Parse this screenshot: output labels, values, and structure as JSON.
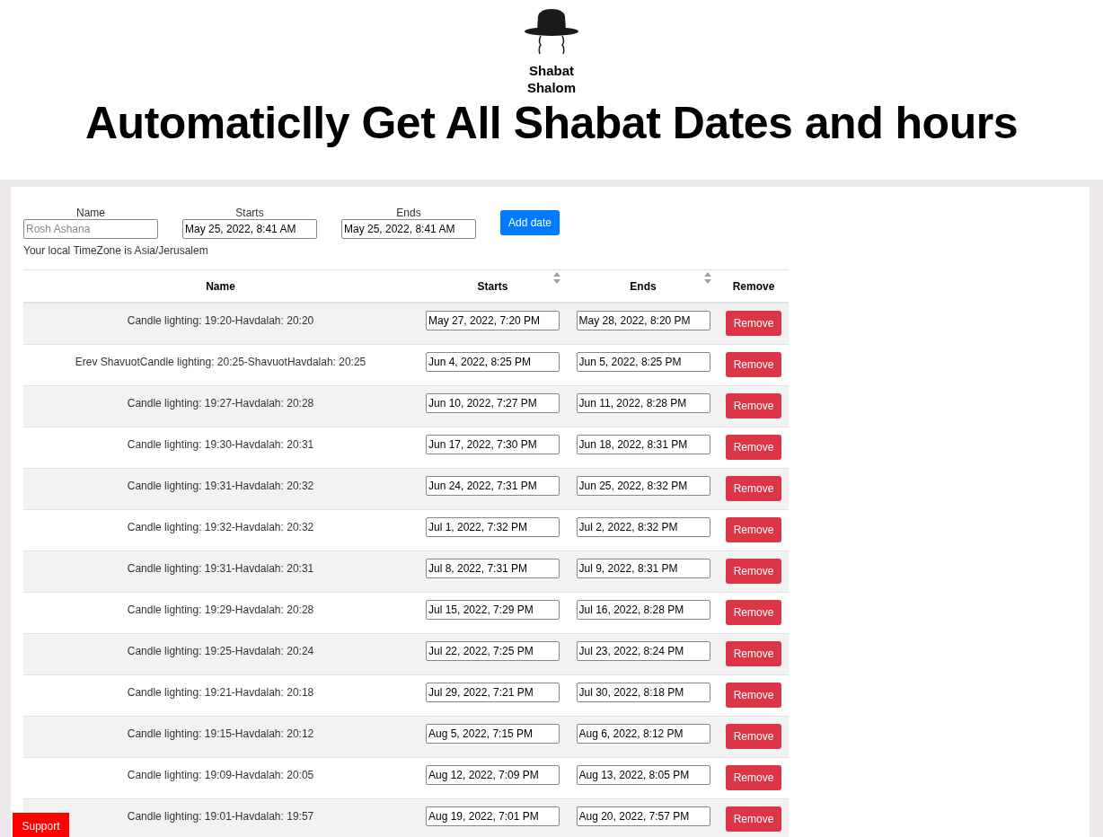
{
  "logo": {
    "text": [
      "Shabat",
      "Shalom"
    ]
  },
  "title": "Automaticlly Get All Shabat Dates and hours",
  "form": {
    "fields": [
      {
        "label": "Name",
        "placeholder": "Rosh Ashana"
      },
      {
        "label": "Starts",
        "value": "May 25, 2022, 8:41 AM"
      },
      {
        "label": "Ends",
        "value": "May 25, 2022, 8:41 AM"
      }
    ],
    "add_button": "Add date",
    "timezone_note": "Your local TimeZone is Asia/Jerusalem"
  },
  "table": {
    "columns": [
      {
        "label": "Name",
        "sortable": false
      },
      {
        "label": "Starts",
        "sortable": true
      },
      {
        "label": "Ends",
        "sortable": true
      },
      {
        "label": "Remove",
        "sortable": false
      }
    ],
    "rows": [
      {
        "name": "Candle lighting: 19:20-Havdalah: 20:20",
        "starts": "May 27, 2022, 7:20 PM",
        "ends": "May 28, 2022, 8:20 PM",
        "button": "Remove"
      },
      {
        "name": "Erev ShavuotCandle lighting: 20:25-ShavuotHavdalah: 20:25",
        "starts": "Jun 4, 2022, 8:25 PM",
        "ends": "Jun 5, 2022, 8:25 PM",
        "button": "Remove"
      },
      {
        "name": "Candle lighting: 19:27-Havdalah: 20:28",
        "starts": "Jun 10, 2022, 7:27 PM",
        "ends": "Jun 11, 2022, 8:28 PM",
        "button": "Remove"
      },
      {
        "name": "Candle lighting: 19:30-Havdalah: 20:31",
        "starts": "Jun 17, 2022, 7:30 PM",
        "ends": "Jun 18, 2022, 8:31 PM",
        "button": "Remove"
      },
      {
        "name": "Candle lighting: 19:31-Havdalah: 20:32",
        "starts": "Jun 24, 2022, 7:31 PM",
        "ends": "Jun 25, 2022, 8:32 PM",
        "button": "Remove"
      },
      {
        "name": "Candle lighting: 19:32-Havdalah: 20:32",
        "starts": "Jul 1, 2022, 7:32 PM",
        "ends": "Jul 2, 2022, 8:32 PM",
        "button": "Remove"
      },
      {
        "name": "Candle lighting: 19:31-Havdalah: 20:31",
        "starts": "Jul 8, 2022, 7:31 PM",
        "ends": "Jul 9, 2022, 8:31 PM",
        "button": "Remove"
      },
      {
        "name": "Candle lighting: 19:29-Havdalah: 20:28",
        "starts": "Jul 15, 2022, 7:29 PM",
        "ends": "Jul 16, 2022, 8:28 PM",
        "button": "Remove"
      },
      {
        "name": "Candle lighting: 19:25-Havdalah: 20:24",
        "starts": "Jul 22, 2022, 7:25 PM",
        "ends": "Jul 23, 2022, 8:24 PM",
        "button": "Remove"
      },
      {
        "name": "Candle lighting: 19:21-Havdalah: 20:18",
        "starts": "Jul 29, 2022, 7:21 PM",
        "ends": "Jul 30, 2022, 8:18 PM",
        "button": "Remove"
      },
      {
        "name": "Candle lighting: 19:15-Havdalah: 20:12",
        "starts": "Aug 5, 2022, 7:15 PM",
        "ends": "Aug 6, 2022, 8:12 PM",
        "button": "Remove"
      },
      {
        "name": "Candle lighting: 19:09-Havdalah: 20:05",
        "starts": "Aug 12, 2022, 7:09 PM",
        "ends": "Aug 13, 2022, 8:05 PM",
        "button": "Remove"
      },
      {
        "name": "Candle lighting: 19:01-Havdalah: 19:57",
        "starts": "Aug 19, 2022, 7:01 PM",
        "ends": "Aug 20, 2022, 7:57 PM",
        "button": "Remove"
      }
    ]
  },
  "support_button": "Support"
}
